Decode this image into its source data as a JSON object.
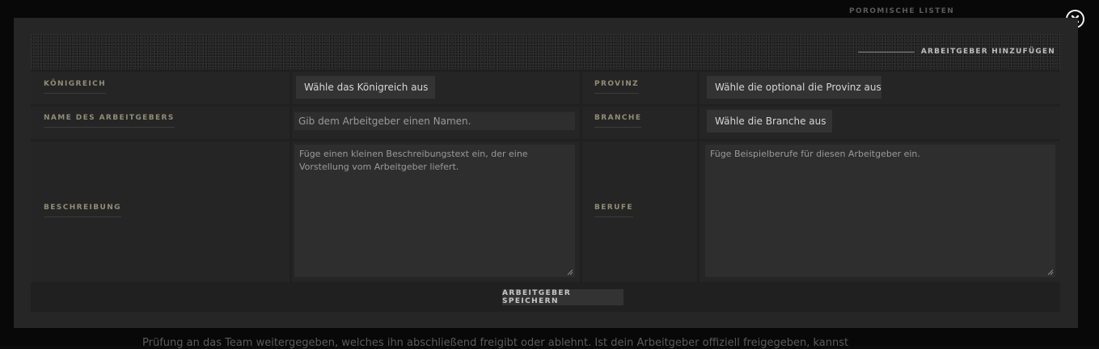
{
  "background": {
    "sidebar_heading": "POROMISCHE LISTEN",
    "body_text": "Prüfung an das Team weitergegeben, welches ihn abschließend freigibt oder ablehnt. Ist dein Arbeitgeber offiziell freigegeben, kannst"
  },
  "modal": {
    "heading": "ARBEITGEBER HINZUFÜGEN",
    "fields": {
      "kingdom": {
        "label": "KÖNIGREICH",
        "value": "Wähle das Königreich aus"
      },
      "province": {
        "label": "PROVINZ",
        "value": "Wähle die optional die Provinz aus"
      },
      "employer_name": {
        "label": "NAME DES ARBEITGEBERS",
        "placeholder": "Gib dem Arbeitgeber einen Namen."
      },
      "industry": {
        "label": "BRANCHE",
        "value": "Wähle die Branche aus"
      },
      "description": {
        "label": "BESCHREIBUNG",
        "placeholder": "Füge einen kleinen Beschreibungstext ein, der eine Vorstellung vom Arbeitgeber liefert."
      },
      "professions": {
        "label": "BERUFE",
        "placeholder": "Füge Beispielberufe für diesen Arbeitgeber ein."
      }
    },
    "save_label": "ARBEITGEBER SPEICHERN"
  },
  "icons": {
    "close": "close-circle-icon",
    "dropdown": "chevron-down-icon",
    "resize": "resize-grip-icon"
  },
  "colors": {
    "background": "#0b0b0b",
    "modal": "#262626",
    "panel": "#202020",
    "label": "#8e8e78"
  }
}
